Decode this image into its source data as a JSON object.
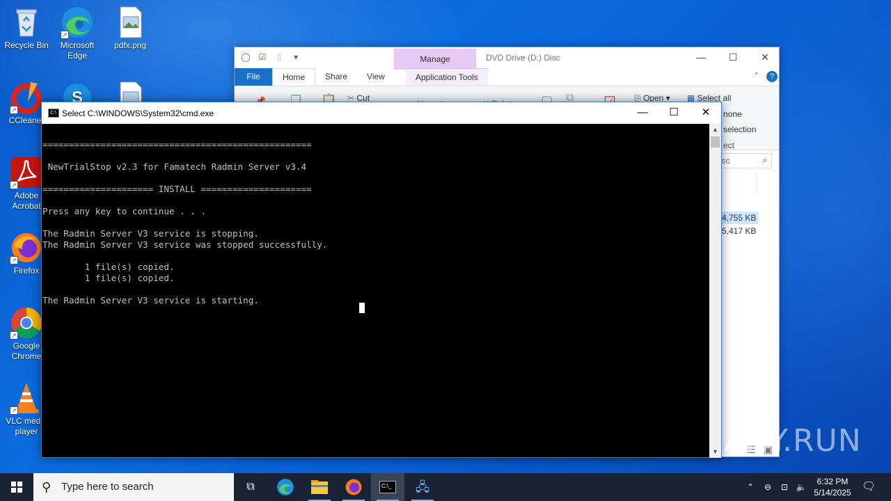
{
  "desktop": {
    "icons": [
      {
        "label": "Recycle Bin",
        "icon": "recycle-bin-icon"
      },
      {
        "label": "Microsoft Edge",
        "icon": "edge-icon"
      },
      {
        "label": "pdfx.png",
        "icon": "image-file-icon"
      },
      {
        "label": "CCleaner",
        "icon": "ccleaner-icon"
      },
      {
        "label": "Adobe Acrobat",
        "icon": "acrobat-icon"
      },
      {
        "label": "Firefox",
        "icon": "firefox-icon"
      },
      {
        "label": "Google Chrome",
        "icon": "chrome-icon"
      },
      {
        "label": "VLC media player",
        "icon": "vlc-icon"
      }
    ]
  },
  "explorer": {
    "title": "DVD Drive (D:) Disc",
    "contextual_tab": "Manage",
    "tabs": [
      "File",
      "Home",
      "Share",
      "View",
      "Application Tools"
    ],
    "ribbon": {
      "cut": "Cut",
      "move_to": "Move to",
      "delete": "Delete",
      "open": "Open",
      "select_all": "Select all",
      "select_none": "none",
      "invert_selection": "selection",
      "select_group": "ect"
    },
    "search_placeholder": "isc",
    "sizes": [
      "4,755 KB",
      "5,417 KB"
    ]
  },
  "cmd": {
    "title": "Select C:\\WINDOWS\\System32\\cmd.exe",
    "lines": [
      "",
      "===================================================",
      "",
      " NewTrialStop v2.3 for Famatech Radmin Server v3.4",
      "",
      "===================== INSTALL =====================",
      "",
      "Press any key to continue . . .",
      "",
      "The Radmin Server V3 service is stopping.",
      "The Radmin Server V3 service was stopped successfully.",
      "",
      "        1 file(s) copied.",
      "        1 file(s) copied.",
      "",
      "The Radmin Server V3 service is starting."
    ]
  },
  "taskbar": {
    "search_placeholder": "Type here to search",
    "time": "6:32 PM",
    "date": "5/14/2025",
    "apps": [
      "task-view-icon",
      "edge-icon",
      "file-explorer-icon",
      "firefox-icon",
      "cmd-icon",
      "installer-icon"
    ]
  },
  "watermark": "ANY.RUN"
}
